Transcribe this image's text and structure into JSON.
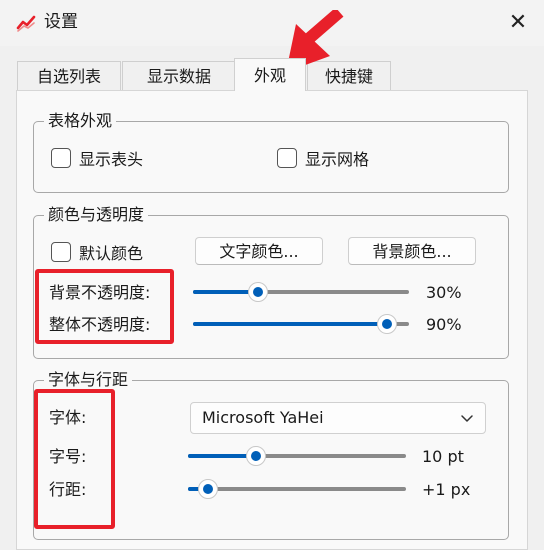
{
  "window": {
    "title": "设置",
    "close_glyph": "✕"
  },
  "tabs": [
    {
      "label": "自选列表",
      "active": false
    },
    {
      "label": "显示数据",
      "active": false
    },
    {
      "label": "外观",
      "active": true
    },
    {
      "label": "快捷键",
      "active": false
    }
  ],
  "table_appearance": {
    "title": "表格外观",
    "show_header": {
      "label": "显示表头",
      "checked": false
    },
    "show_grid": {
      "label": "显示网格",
      "checked": false
    }
  },
  "color_opacity": {
    "title": "颜色与透明度",
    "default_color": {
      "label": "默认颜色",
      "checked": false
    },
    "text_color_button": "文字颜色...",
    "bg_color_button": "背景颜色...",
    "bg_opacity": {
      "label": "背景不透明度:",
      "value_text": "30%",
      "fraction": 0.3
    },
    "overall_opacity": {
      "label": "整体不透明度:",
      "value_text": "90%",
      "fraction": 0.9
    }
  },
  "font_spacing": {
    "title": "字体与行距",
    "font": {
      "label": "字体:",
      "value": "Microsoft YaHei"
    },
    "size": {
      "label": "字号:",
      "value_text": "10 pt",
      "fraction": 0.31
    },
    "line_spacing": {
      "label": "行距:",
      "value_text": "+1 px",
      "fraction": 0.09
    }
  },
  "colors": {
    "accent": "#005fb8",
    "annotation": "#e8202a",
    "app_icon": "#e8202a"
  },
  "icons": {
    "app": "chart-line-icon",
    "close": "close-icon",
    "dropdown": "chevron-down-icon",
    "annotation_arrow": "red-arrow-icon"
  }
}
